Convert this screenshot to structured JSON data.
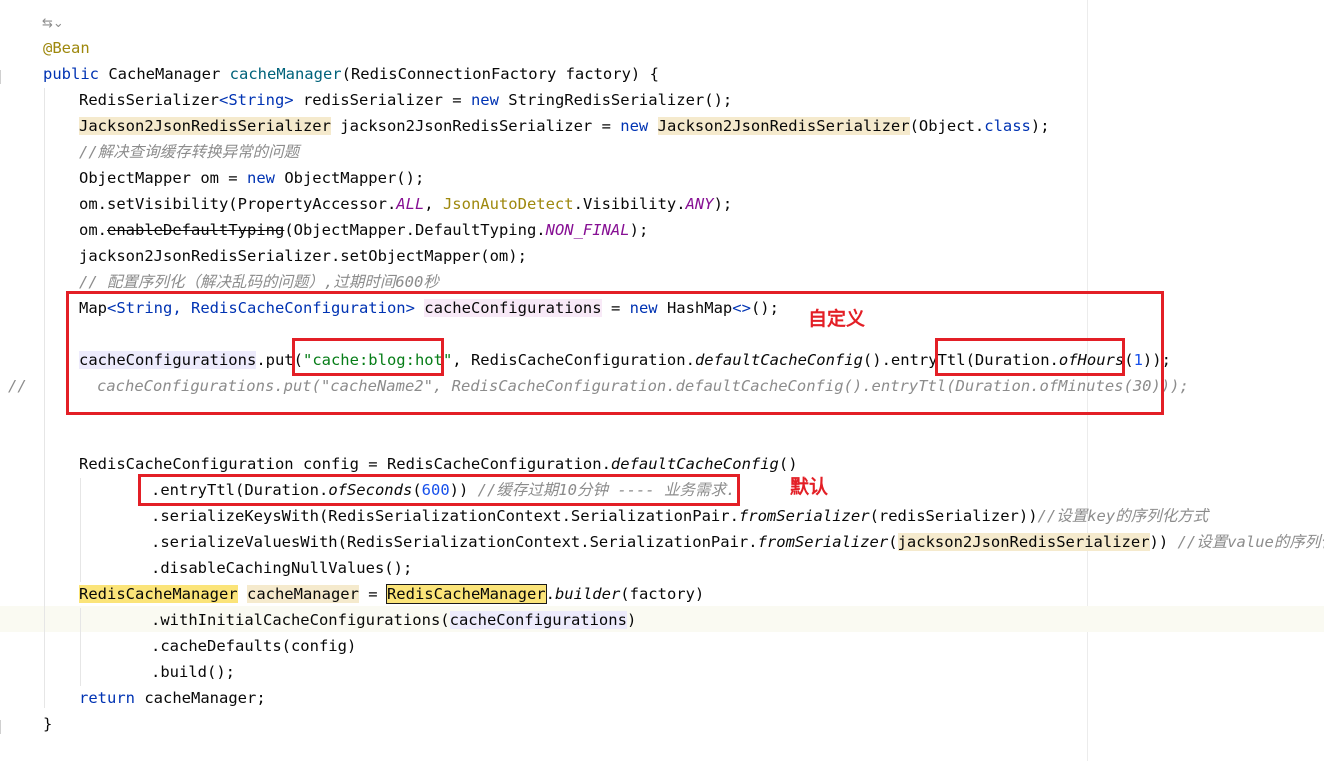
{
  "editor": {
    "gutter_icon": "fold-toggle-icon",
    "gutter_comment_marker": "//",
    "lines": {
      "l0_ann": "@Bean",
      "l1_public": "public",
      "l1_type": " CacheManager ",
      "l1_name": "cacheManager",
      "l1_params": "(RedisConnectionFactory factory) {",
      "l2_a": "RedisSerializer",
      "l2_b": "<String>",
      "l2_c": " redisSerializer = ",
      "l2_new": "new",
      "l2_d": " StringRedisSerializer();",
      "l3_a": "Jackson2JsonRedisSerializer",
      "l3_b": " jackson2JsonRedisSerializer = ",
      "l3_new": "new",
      "l3_c": "Jackson2JsonRedisSerializer",
      "l3_d": "(Object.",
      "l3_class": "class",
      "l3_e": ");",
      "l4_cmt": "//解决查询缓存转换异常的问题",
      "l5_a": "ObjectMapper om = ",
      "l5_new": "new",
      "l5_b": " ObjectMapper();",
      "l6_a": "om.setVisibility(PropertyAccessor.",
      "l6_all": "ALL",
      "l6_b": ", ",
      "l6_c": "JsonAutoDetect",
      "l6_d": ".Visibility.",
      "l6_any": "ANY",
      "l6_e": ");",
      "l7_a": "om.",
      "l7_dep": "enableDefaultTyping",
      "l7_b": "(ObjectMapper.DefaultTyping.",
      "l7_nf": "NON_FINAL",
      "l7_c": ");",
      "l8": "jackson2JsonRedisSerializer.setObjectMapper(om);",
      "l9_cmt": "// 配置序列化（解决乱码的问题）,过期时间600秒",
      "l10_a": "Map",
      "l10_b": "<String, RedisCacheConfiguration>",
      "l10_c": " ",
      "l10_var": "cacheConfigurations",
      "l10_d": " = ",
      "l10_new": "new",
      "l10_e": " HashMap",
      "l10_f": "<>",
      "l10_g": "();",
      "l12_var": "cacheConfigurations",
      "l12_a": ".put(",
      "l12_str": "\"cache:blog:hot\"",
      "l12_b": ", RedisCacheConfiguration.",
      "l12_m": "defaultCacheConfig",
      "l12_c": "().entryTtl(Duration.",
      "l12_m2": "ofHours",
      "l12_d": "(",
      "l12_num": "1",
      "l12_e": "));",
      "l13_cmt": "cacheConfigurations.put(\"cacheName2\", RedisCacheConfiguration.defaultCacheConfig().entryTtl(Duration.ofMinutes(30)));",
      "l16_a": "RedisCacheConfiguration config = RedisCacheConfiguration.",
      "l16_m": "defaultCacheConfig",
      "l16_b": "()",
      "l17_a": ".entryTtl(Duration.",
      "l17_m": "ofSeconds",
      "l17_b": "(",
      "l17_num": "600",
      "l17_c": ")) ",
      "l17_cmt": "//缓存过期10分钟 ---- 业务需求.",
      "l18_a": ".serializeKeysWith(RedisSerializationContext.SerializationPair.",
      "l18_m": "fromSerializer",
      "l18_b": "(redisSerializer))",
      "l18_cmt": "//设置key的序列化方式",
      "l19_a": ".serializeValuesWith(RedisSerializationContext.SerializationPair.",
      "l19_m": "fromSerializer",
      "l19_b": "(",
      "l19_var": "jackson2JsonRedisSerializer",
      "l19_c": ")) ",
      "l19_cmt": "//设置value的序列化",
      "l20": ".disableCachingNullValues();",
      "l21_a": "RedisCacheManager",
      "l21_b": " ",
      "l21_c": "cacheManager",
      "l21_d": " = ",
      "l21_e": "RedisCacheManager",
      "l21_f": ".",
      "l21_m": "builder",
      "l21_g": "(factory)",
      "l22_a": ".withInitialCacheConfigurations(",
      "l22_var": "cacheConfigurations",
      "l22_b": ")",
      "l23": ".cacheDefaults(config)",
      "l24": ".build();",
      "l25_kw": "return",
      "l25_b": " cacheManager;",
      "l26": "}"
    }
  },
  "annotations": {
    "custom_label": "自定义",
    "default_label": "默认",
    "color": "#e31f26"
  }
}
